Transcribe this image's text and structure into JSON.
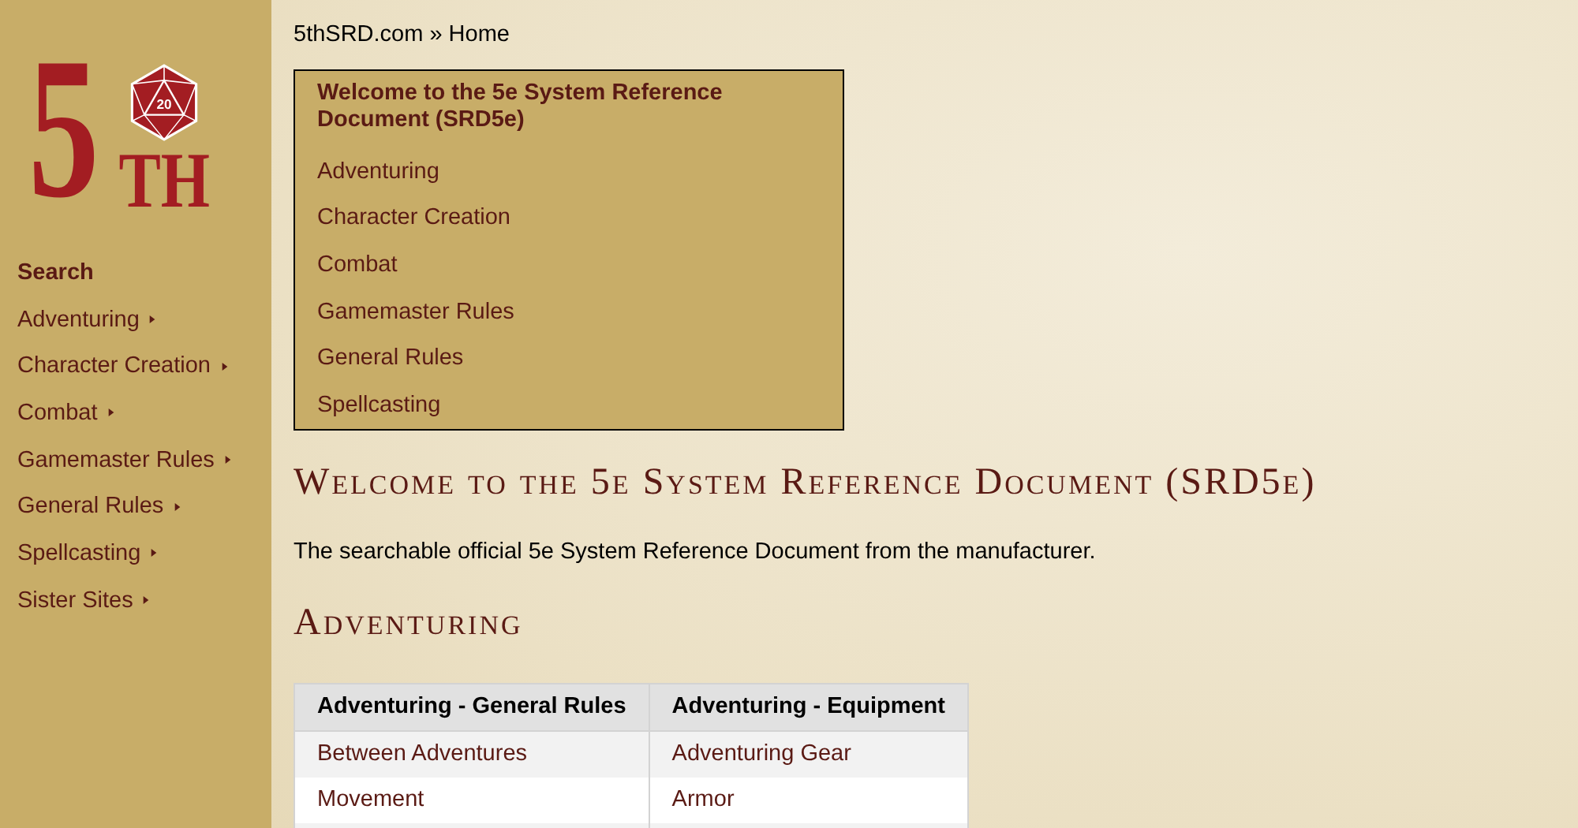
{
  "logo": {
    "numeral": "5",
    "suffix": "TH",
    "die_label": "20"
  },
  "sidebar": {
    "items": [
      {
        "label": "Search",
        "bold": true,
        "has_submenu": false
      },
      {
        "label": "Adventuring",
        "bold": false,
        "has_submenu": true
      },
      {
        "label": "Character Creation",
        "bold": false,
        "has_submenu": true
      },
      {
        "label": "Combat",
        "bold": false,
        "has_submenu": true
      },
      {
        "label": "Gamemaster Rules",
        "bold": false,
        "has_submenu": true
      },
      {
        "label": "General Rules",
        "bold": false,
        "has_submenu": true
      },
      {
        "label": "Spellcasting",
        "bold": false,
        "has_submenu": true
      },
      {
        "label": "Sister Sites",
        "bold": false,
        "has_submenu": true
      }
    ]
  },
  "breadcrumb": {
    "link": "5thSRD.com",
    "separator": "»",
    "current": "Home"
  },
  "toc": {
    "title": "Welcome to the 5e System Reference Document (SRD5e)",
    "items": [
      "Adventuring",
      "Character Creation",
      "Combat",
      "Gamemaster Rules",
      "General Rules",
      "Spellcasting"
    ]
  },
  "heading": "Welcome to the 5e System Reference Document (SRD5e)",
  "intro": "The searchable official 5e System Reference Document from the manufacturer.",
  "section_heading": "Adventuring",
  "table": {
    "columns": [
      "Adventuring - General Rules",
      "Adventuring - Equipment"
    ],
    "rows": [
      [
        "Between Adventures",
        "Adventuring Gear"
      ],
      [
        "Movement",
        "Armor"
      ]
    ]
  }
}
